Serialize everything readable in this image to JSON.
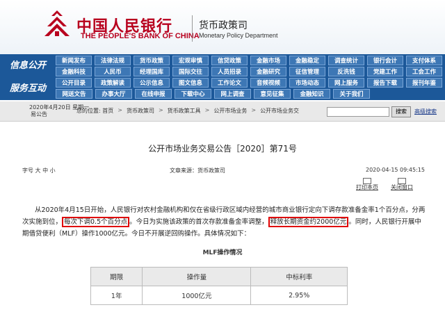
{
  "header": {
    "logo_cn": "中国人民银行",
    "logo_en": "THE PEOPLE'S BANK OF CHINA",
    "dept_cn": "货币政策司",
    "dept_en": "Monetary Policy Department"
  },
  "nav": {
    "sections": [
      "信息公开",
      "服务互动"
    ],
    "rows": [
      [
        "新闻发布",
        "法律法规",
        "货币政策",
        "宏观审慎",
        "信贷政策",
        "金融市场",
        "金融稳定",
        "调查统计",
        "银行会计",
        "支付体系"
      ],
      [
        "金融科技",
        "人民币",
        "经理国库",
        "国际交往",
        "人员招录",
        "金融研究",
        "征信管理",
        "反洗钱",
        "党建工作",
        "工会工作"
      ],
      [
        "公开目录",
        "政策解读",
        "公示信息",
        "图文信息",
        "工作论文",
        "音频视频",
        "市场动态",
        "网上服务",
        "报告下载",
        "报刊年鉴"
      ],
      [
        "网送文告",
        "办事大厅",
        "在线申报",
        "下载中心",
        "网上调查",
        "意见征集",
        "金融知识",
        "关于我们",
        "",
        ""
      ]
    ]
  },
  "toolbar": {
    "date_line1": "2020年4月20日 星期一",
    "date_line2": "易公告",
    "breadcrumb": [
      "您的位置: 首页",
      ">",
      "货币政策司",
      ">",
      "货币政策工具",
      ">",
      "公开市场业务",
      ">",
      "公开市场业务交"
    ],
    "search_button": "搜索",
    "advanced_search": "高级搜索"
  },
  "article": {
    "title": "公开市场业务交易公告［2020］第71号",
    "font_size": "字号 大 中 小",
    "source": "文章来源：货币政策司",
    "date": "2020-04-15 09:45:15",
    "print": "打印本页",
    "close": "关闭窗口",
    "p1_a": "从2020年4月15日开始，人民银行对农村金融机构和仅在省级行政区域内经营的城市商业银行定向下调存款准备金率1个百分点，分两次实施到位，",
    "p1_hl1": "每次下调0.5个百分点",
    "p1_b": "。今日为实施该政策的首次存款准备金率调整，",
    "p1_hl2": "释放长期资金约2000亿元",
    "p1_c": "。同时，人民银行开展中期借贷便利（MLF）操作1000亿元。今日不开展逆回购操作。具体情况如下：",
    "table_title": "MLF操作情况",
    "table": {
      "headers": [
        "期限",
        "操作量",
        "中标利率"
      ],
      "rows": [
        [
          "1年",
          "1000亿元",
          "2.95%"
        ]
      ]
    }
  }
}
